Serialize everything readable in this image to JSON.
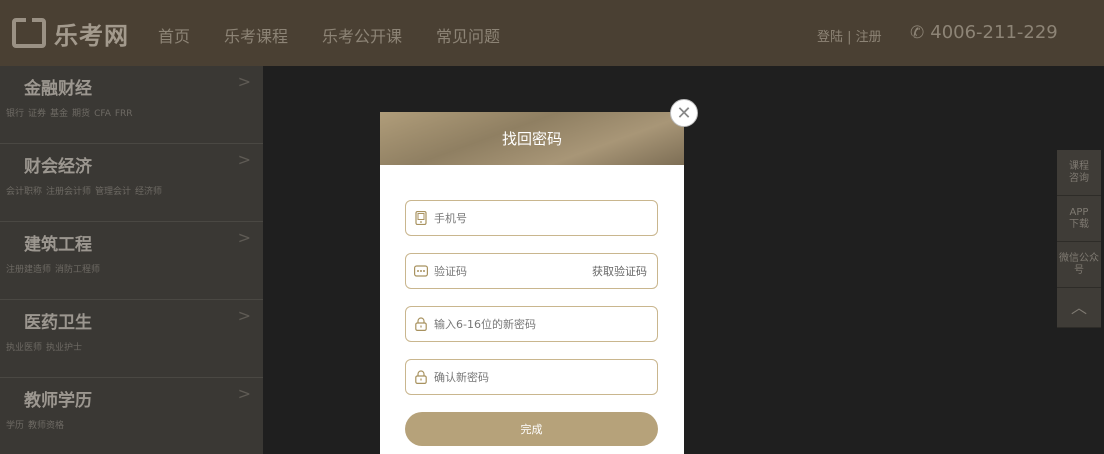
{
  "header": {
    "logo_text": "乐考网",
    "nav": [
      "首页",
      "乐考课程",
      "乐考公开课",
      "常见问题"
    ],
    "login": "登陆",
    "separator": " | ",
    "register": "注册",
    "phone": "4006-211-229"
  },
  "sidebar": {
    "categories": [
      {
        "title": "金融财经",
        "tags": [
          "银行",
          "证券",
          "基金",
          "期货",
          "CFA",
          "FRR"
        ]
      },
      {
        "title": "财会经济",
        "tags": [
          "会计职称",
          "注册会计师",
          "管理会计",
          "经济师"
        ]
      },
      {
        "title": "建筑工程",
        "tags": [
          "注册建造师",
          "消防工程师"
        ]
      },
      {
        "title": "医药卫生",
        "tags": [
          "执业医师",
          "执业护士"
        ]
      },
      {
        "title": "教师学历",
        "tags": [
          "学历",
          "教师资格"
        ]
      }
    ]
  },
  "modal": {
    "title": "找回密码",
    "phone_placeholder": "手机号",
    "code_placeholder": "验证码",
    "get_code": "获取验证码",
    "new_password_placeholder": "输入6-16位的新密码",
    "confirm_password_placeholder": "确认新密码",
    "submit": "完成"
  },
  "float_panel": {
    "consult": "课程咨询",
    "app": "APP下载",
    "wechat": "微信公众号"
  }
}
